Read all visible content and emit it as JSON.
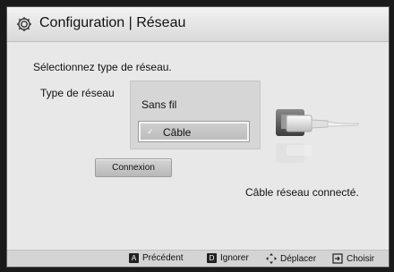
{
  "header": {
    "title": "Configuration | Réseau",
    "icon": "gear-icon"
  },
  "main": {
    "prompt": "Sélectionnez type de réseau.",
    "type_label": "Type de réseau",
    "network_options": [
      "Sans fil",
      "Câble"
    ],
    "selected_option": "Câble",
    "connect_button": "Connexion",
    "status": "Câble réseau connecté."
  },
  "footer": {
    "prev": "Précédent",
    "prev_key": "A",
    "ignore": "Ignorer",
    "ignore_key": "D",
    "move": "Déplacer",
    "choose": "Choisir"
  },
  "colors": {
    "background": "#e8e8e8",
    "title_bar": "#e0e0e0",
    "dropdown": "#d6d6d6",
    "footer": "#d4d4d4"
  }
}
